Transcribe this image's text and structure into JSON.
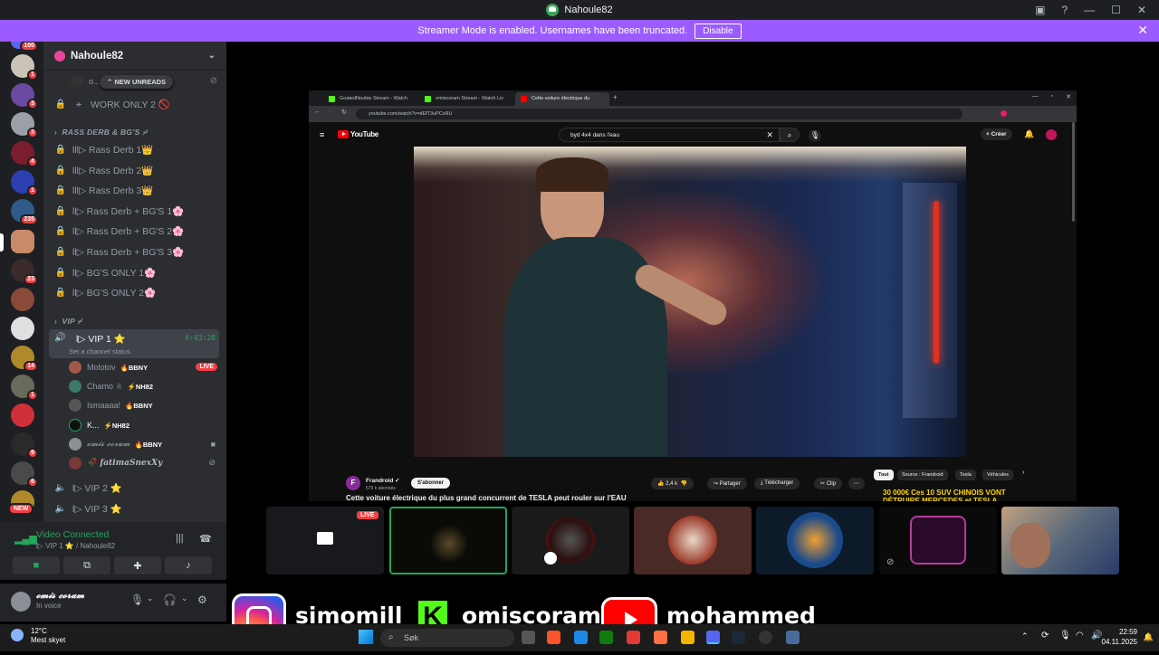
{
  "titlebar": {
    "title": "Nahoule82"
  },
  "banner": {
    "text": "Streamer Mode is enabled. Usernames have been truncated.",
    "button": "Disable"
  },
  "servers": {
    "badges": [
      "100",
      "1",
      "3",
      "3",
      "4",
      "1",
      "235",
      "",
      "23",
      "",
      "14",
      "1",
      "",
      "9",
      "6",
      "NEW"
    ]
  },
  "sidebar": {
    "server_name": "Nahoule82",
    "new_unreads": "NEW UNREADS",
    "top_user": "o...",
    "channels": [
      {
        "label": "WORK ONLY 2 🚫",
        "icon": "⚹"
      },
      {
        "label": "lll▷ Rass Derb 1👑",
        "icon": "🔒"
      },
      {
        "label": "lll▷ Rass Derb 2👑",
        "icon": "🔒"
      },
      {
        "label": "lll▷ Rass Derb 3👑",
        "icon": "🔒"
      },
      {
        "label": "ll▷ Rass Derb + BG'S 1🌸",
        "icon": "🔒"
      },
      {
        "label": "ll▷ Rass Derb + BG'S 2🌸",
        "icon": "🔒"
      },
      {
        "label": "ll▷ Rass Derb + BG'S 3🌸",
        "icon": "🔒"
      },
      {
        "label": "ll▷ BG'S ONLY 1🌸",
        "icon": "🔒"
      },
      {
        "label": "ll▷ BG'S ONLY 2🌸",
        "icon": "🔒"
      }
    ],
    "category1": "RASS DERB & BG'S ⌿",
    "category2": "VIP ⌿",
    "vip1": {
      "name": "l▷ VIP 1 ⭐",
      "time": "6:43:28",
      "status": "Set a channel status"
    },
    "users": [
      {
        "name": "Molotov",
        "tag": "🔥BBNY",
        "live": "LIVE",
        "color": "#a05a4a"
      },
      {
        "name": "Chamo ♕",
        "tag": "⚡NH82",
        "live": "",
        "color": "#3a7a6a"
      },
      {
        "name": "Ismaaaa!",
        "tag": "🔥BBNY",
        "live": "",
        "color": "#555"
      },
      {
        "name": "K...",
        "tag": "⚡NH82",
        "live": "",
        "color": "#2d7d46"
      },
      {
        "name": "𝓸𝓶𝓲𝓼 𝓬𝓸𝓻𝓪𝓶",
        "tag": "🔥BBNY",
        "live": "",
        "color": "#8b8f96"
      },
      {
        "name": "🥀 𝒇𝒂𝒕𝒊𝒎𝒂𝑺𝒏𝒆𝒙𝑿𝒚",
        "tag": "",
        "live": "",
        "color": "#7a3a3a"
      }
    ],
    "vip2": "l▷ VIP 2 ⭐",
    "vip3": "l▷ VIP 3 ⭐"
  },
  "voice": {
    "status": "Video Connected",
    "channel": "l▷ VIP 1 ⭐ / Nahoule82"
  },
  "user_panel": {
    "name": "𝓸𝓶𝓲𝓼 𝓬𝓸𝓻𝓪𝓶",
    "status": "In voice"
  },
  "browser": {
    "tabs": [
      "GoatedNoobie Stream - Watch",
      "omiscoram Stream - Watch Liv",
      "Cette voiture électrique du"
    ],
    "url": "youtube.com/watch?v=dEfT3uPCzRU",
    "search": "byd 4x4 dans l'eau",
    "create": "+ Créer",
    "video_title": "Cette voiture électrique du plus grand concurrent de TESLA peut rouler sur l'EAU",
    "channel": "Frandroid ✓",
    "subs": "579 k abonnés",
    "subscribe": "S'abonner",
    "likes": "2,4 k",
    "share": "Partager",
    "download": "Télécharger",
    "clip": "Clip",
    "chips": [
      "Tout",
      "Source : Frandroid",
      "Tesla",
      "Véhicules"
    ],
    "rec": "30 000€ Ces 10 SUV CHINOIS VONT DÉTRUIRE MERCEDES et TESLA"
  },
  "stream_grid": {
    "live": "LIVE"
  },
  "social": {
    "instagram": "simomill",
    "kick": "omiscoram",
    "youtube": "mohammed sebrani"
  },
  "taskbar": {
    "temp": "12°C",
    "weather": "Mest skyet",
    "search": "Søk",
    "time": "22:59",
    "date": "04.11.2025"
  }
}
